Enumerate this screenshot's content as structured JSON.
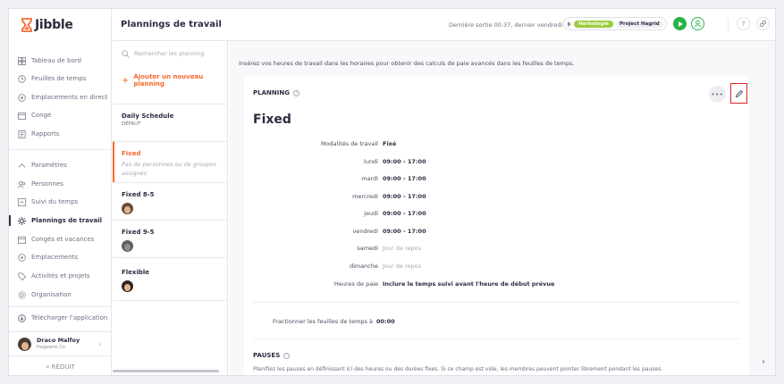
{
  "brand": {
    "name": "Jibble",
    "logo_icon": "hourglass-logo-icon",
    "accent": "#f56a2f"
  },
  "sidebar": {
    "items": [
      {
        "label": "Tableau de bord",
        "icon": "dashboard-icon"
      },
      {
        "label": "Feuilles de temps",
        "icon": "clock-icon"
      },
      {
        "label": "Emplacements en direct",
        "icon": "location-icon"
      },
      {
        "label": "Congé",
        "icon": "calendar-icon"
      },
      {
        "label": "Rapports",
        "icon": "report-icon"
      },
      {
        "label": "Paramètres",
        "icon": "chevron-up-icon"
      },
      {
        "label": "Personnes",
        "icon": "people-icon"
      },
      {
        "label": "Suivi du temps",
        "icon": "time-tracking-icon"
      },
      {
        "label": "Plannings de travail",
        "icon": "sun-icon",
        "active": true
      },
      {
        "label": "Congés et vacances",
        "icon": "calendar-icon"
      },
      {
        "label": "Emplacements",
        "icon": "location-icon"
      },
      {
        "label": "Activités et projets",
        "icon": "tag-icon"
      },
      {
        "label": "Organisation",
        "icon": "gear-icon"
      }
    ],
    "download_label": "Télécharger l'application",
    "user": {
      "name": "Draco Malfoy",
      "org": "Hogwarts Co"
    },
    "reduce_label": "« RÉDUIT"
  },
  "header": {
    "title": "Plannings de travail",
    "last_exit": "Dernière sortie 00:37, dernier vendredi",
    "activity_tag": "Herbologie",
    "project_tag": "Project Hagrid",
    "activity_color": "#9ccc3b",
    "play_color": "#27b24a"
  },
  "schedules": {
    "search_placeholder": "Rechercher les planning",
    "add_label": "Ajouter un nouveau planning",
    "items": [
      {
        "name": "Daily Schedule",
        "sub": "DÉFAUT"
      },
      {
        "name": "Fixed",
        "empty": "Pas de personnes ou de groupes assignés"
      },
      {
        "name": "Fixed 8-5"
      },
      {
        "name": "Fixed 9-5"
      },
      {
        "name": "Flexible"
      }
    ]
  },
  "main": {
    "intro": "Insérez vos heures de travail dans les horaires pour obtenir des calculs de paie avancés dans les feuilles de temps.",
    "section_label": "PLANNING",
    "schedule_title": "Fixed",
    "details": [
      {
        "label": "Modalités de travail",
        "value": "Fixé"
      },
      {
        "label": "lundi",
        "value": "09:00  -  17:00"
      },
      {
        "label": "mardi",
        "value": "09:00  -  17:00"
      },
      {
        "label": "mercredi",
        "value": "09:00  -  17:00"
      },
      {
        "label": "jeudi",
        "value": "09:00  -  17:00"
      },
      {
        "label": "vendredi",
        "value": "09:00  -  17:00"
      },
      {
        "label": "samedi",
        "value": "Jour de repos"
      },
      {
        "label": "dimanche",
        "value": "Jour de repos"
      },
      {
        "label": "Heures de paie",
        "value": "Inclure le temps suivi avant l'heure de début prévue"
      }
    ],
    "split_label": "Fractionner les feuilles de temps à",
    "split_value": "00:00",
    "pauses_label": "PAUSES",
    "pauses_desc": "Planifiez les pauses en définissant ici des heures ou des durées fixes. Si ce champ est vide, les membres peuvent pointer librement pendant les pauses."
  }
}
